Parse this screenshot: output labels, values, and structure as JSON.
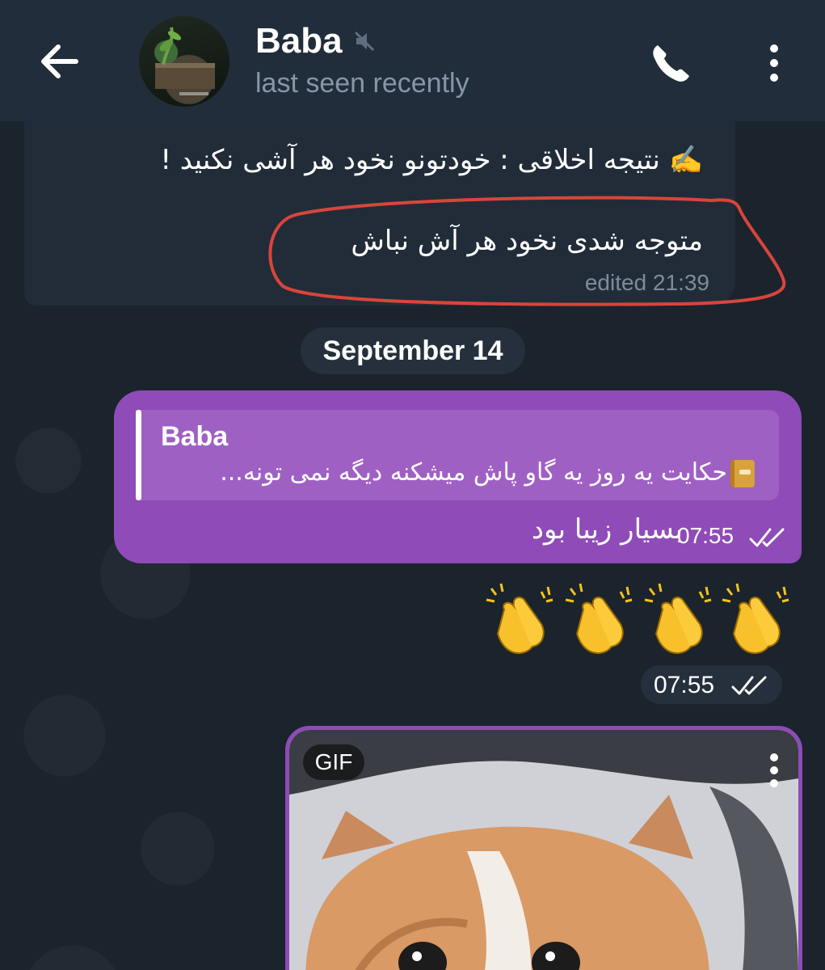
{
  "header": {
    "contact_name": "Baba",
    "status": "last seen recently",
    "icons": {
      "back": "arrow-left-icon",
      "mute": "muted-speaker-icon",
      "call": "phone-icon",
      "menu": "more-vertical-icon"
    }
  },
  "messages": {
    "incoming": {
      "line1": "✍️ نتیجه اخلاقی : خودتونو نخود هر آشی نکنید !",
      "line2": "متوجه شدی نخود هر آش نباش",
      "meta": "edited 21:39"
    },
    "date_separator": "September 14",
    "outgoing_reply": {
      "reply_to_name": "Baba",
      "reply_preview": "حکایت  یه روز یه گاو پاش میشکنه دیگه نمی تونه...",
      "text": "بسیار زیبا بود",
      "time": "07:55",
      "status": "read"
    },
    "outgoing_emoji": {
      "emojis": [
        "👏",
        "👏",
        "👏",
        "👏"
      ],
      "time": "07:55",
      "status": "read"
    },
    "outgoing_gif": {
      "badge": "GIF"
    }
  },
  "colors": {
    "header_bg": "#212d3b",
    "incoming_bubble": "#212c38",
    "outgoing_bubble": "#8f4bb7",
    "annotation_circle": "#d9453b"
  }
}
